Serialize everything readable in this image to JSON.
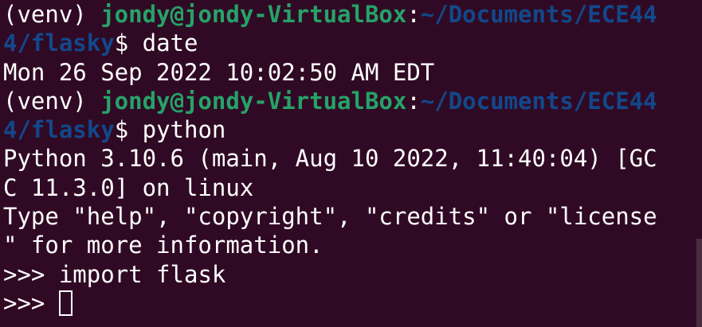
{
  "terminal": {
    "lines": [
      {
        "venv": "(venv) ",
        "user_host": "jondy@jondy-VirtualBox",
        "colon": ":",
        "path_part1": "~/Documents/ECE44"
      },
      {
        "path_part2": "4/flasky",
        "prompt": "$ ",
        "command": "date"
      },
      {
        "output": "Mon 26 Sep 2022 10:02:50 AM EDT"
      },
      {
        "venv": "(venv) ",
        "user_host": "jondy@jondy-VirtualBox",
        "colon": ":",
        "path_part1": "~/Documents/ECE44"
      },
      {
        "path_part2": "4/flasky",
        "prompt": "$ ",
        "command": "python"
      },
      {
        "output": "Python 3.10.6 (main, Aug 10 2022, 11:40:04) [GC"
      },
      {
        "output": "C 11.3.0] on linux"
      },
      {
        "output": "Type \"help\", \"copyright\", \"credits\" or \"license"
      },
      {
        "output": "\" for more information."
      },
      {
        "repl_prompt": ">>> ",
        "command": "import flask"
      },
      {
        "repl_prompt": ">>> "
      }
    ],
    "colors": {
      "background": "#300a24",
      "text": "#ffffff",
      "user_host": "#26a269",
      "path": "#12488b"
    }
  }
}
